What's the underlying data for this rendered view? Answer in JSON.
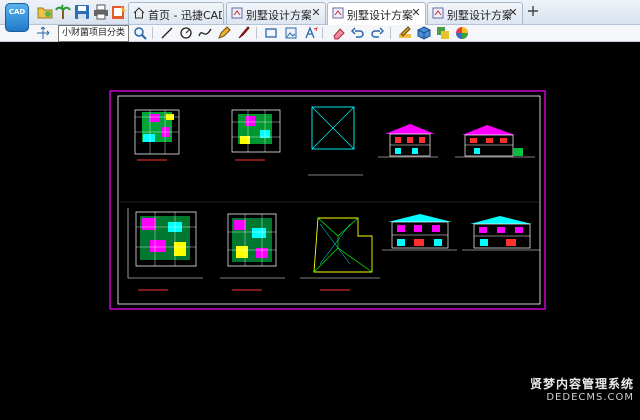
{
  "tabs": [
    {
      "label": "首页 - 迅捷CAD",
      "icon": "home-icon",
      "active": false
    },
    {
      "label": "别墅设计方案...",
      "icon": "drawing-file-icon",
      "active": false
    },
    {
      "label": "别墅设计方案...",
      "icon": "drawing-file-icon",
      "active": true
    },
    {
      "label": "别墅设计方案...",
      "icon": "drawing-file-icon",
      "active": false
    }
  ],
  "tooltip": "小财菌项目分类",
  "logo_text": "CAD",
  "watermark": {
    "line1": "贤梦内容管理系统",
    "line2": "DEDECMS.COM"
  },
  "colors": {
    "frame": "#ff00ff",
    "cad_magenta": "#ff00ff",
    "cad_cyan": "#00ffff",
    "cad_green": "#00ff00",
    "cad_yellow": "#ffff00",
    "cad_red": "#ff3030",
    "cad_white": "#ffffff"
  }
}
